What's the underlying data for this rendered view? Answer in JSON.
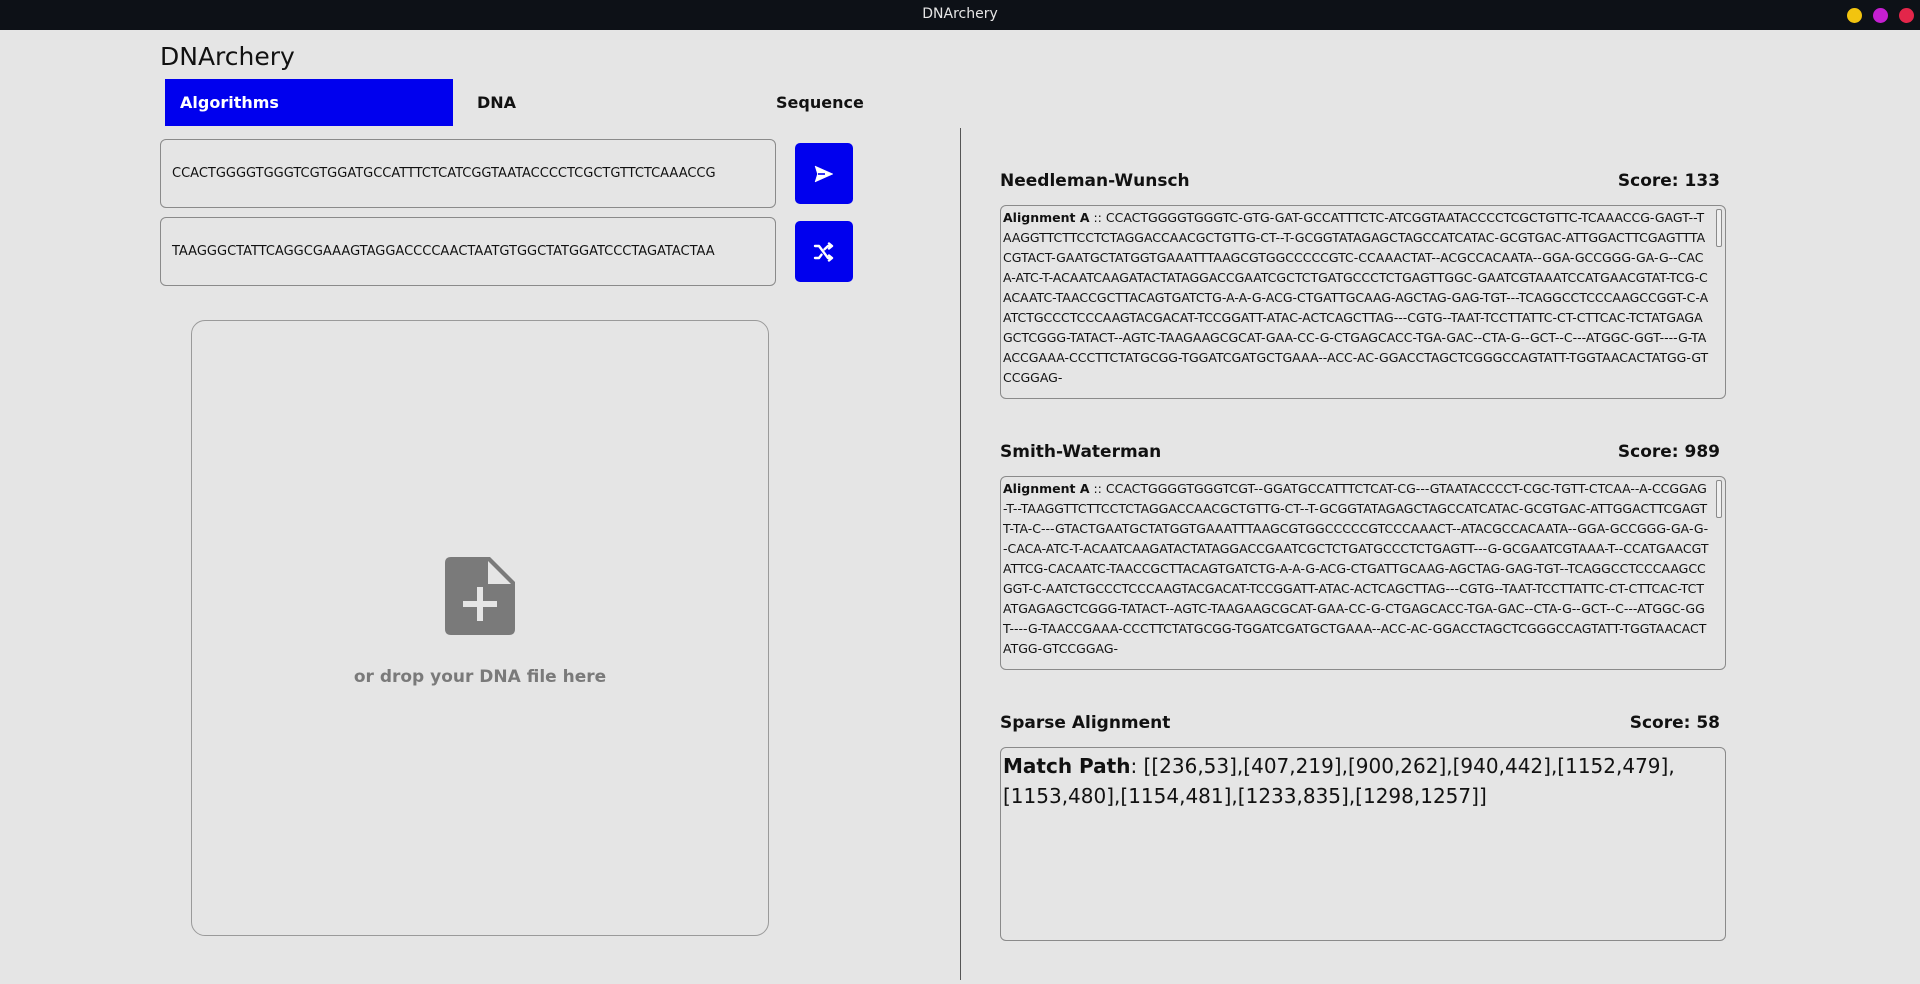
{
  "window": {
    "title": "DNArchery"
  },
  "app": {
    "title": "DNArchery"
  },
  "tabs": [
    {
      "label": "Algorithms",
      "active": true
    },
    {
      "label": "DNA",
      "active": false
    },
    {
      "label": "Sequence",
      "active": false
    }
  ],
  "inputs": {
    "sequence_a": "CCACTGGGGTGGGTCGTGGATGCCATTTCTCATCGGTAATACCCCTCGCTGTTCTCAAACCG",
    "sequence_b": "TAAGGGCTATTCAGGCGAAAGTAGGACCCCAACTAATGTGGCTATGGATCCCTAGATACTAA"
  },
  "buttons": {
    "send_icon": "send-icon",
    "shuffle_icon": "shuffle-icon"
  },
  "dropzone": {
    "icon": "file-add-icon",
    "text": "or drop your DNA file here"
  },
  "results": {
    "needleman": {
      "title": "Needleman-Wunsch",
      "score": "Score: 133",
      "label": "Alignment A",
      "separator": " :: ",
      "text": "CCACTGGGGTGGGTC-GTG-GAT-GCCATTTCTC-ATCGGTAATACCCCTCGCTGTTC-TCAAACCG-GAGT--TAAGGTTCTTCCTCTAGGACCAACGCTGTTG-CT--T-GCGGTATAGAGCTAGCCATCATAC-GCGTGAC-ATTGGACTTCGAGTTTACGTACT-GAATGCTATGGTGAAATTTAAGCGTGGCCCCCGTC-CCAAACTAT--ACGCCACAATA--GGA-GCCGGG-GA-G--CACA-ATC-T-ACAATCAAGATACTATAGGACCGAATCGCTCTGATGCCCTCTGAGTTGGC-GAATCGTAAATCCATGAACGTAT-TCG-CACAATC-TAACCGCTTACAGTGATCTG-A-A-G-ACG-CTGATTGCAAG-AGCTAG-GAG-TGT---TCAGGCCTCCCAAGCCGGT-C-AATCTGCCCTCCCAAGTACGACAT-TCCGGATT-ATAC-ACTCAGCTTAG---CGTG--TAAT-TCCTTATTC-CT-CTTCAC-TCTATGAGAGCTCGGG-TATACT--AGTC-TAAGAAGCGCAT-GAA-CC-G-CTGAGCACC-TGA-GAC--CTA-G--GCT--C---ATGGC-GGT----G-TAACCGAAA-CCCTTCTATGCGG-TGGATCGATGCTGAAA--ACC-AC-GGACCTAGCTCGGGCCAGTATT-TGGTAACACTATGG-GTCCGGAG-"
    },
    "smith": {
      "title": "Smith-Waterman",
      "score": "Score: 989",
      "label": "Alignment A",
      "separator": " :: ",
      "text": "CCACTGGGGTGGGTCGT--GGATGCCATTTCTCAT-CG---GTAATACCCCT-CGC-TGTT-CTCAA--A-CCGGAG-T--TAAGGTTCTTCCTCTAGGACCAACGCTGTTG-CT--T-GCGGTATAGAGCTAGCCATCATAC-GCGTGAC-ATTGGACTTCGAGTT-TA-C---GTACTGAATGCTATGGTGAAATTTAAGCGTGGCCCCCGTCCCAAACT--ATACGCCACAATA--GGA-GCCGGG-GA-G--CACA-ATC-T-ACAATCAAGATACTATAGGACCGAATCGCTCTGATGCCCTCTGAGTT---G-GCGAATCGTAAA-T--CCATGAACGTATTCG-CACAATC-TAACCGCTTACAGTGATCTG-A-A-G-ACG-CTGATTGCAAG-AGCTAG-GAG-TGT--TCAGGCCTCCCAAGCCGGT-C-AATCTGCCCTCCCAAGTACGACAT-TCCGGATT-ATAC-ACTCAGCTTAG---CGTG--TAAT-TCCTTATTC-CT-CTTCAC-TCTATGAGAGCTCGGG-TATACT--AGTC-TAAGAAGCGCAT-GAA-CC-G-CTGAGCACC-TGA-GAC--CTA-G--GCT--C---ATGGC-GGT----G-TAACCGAAA-CCCTTCTATGCGG-TGGATCGATGCTGAAA--ACC-AC-GGACCTAGCTCGGGCCAGTATT-TGGTAACACTATGG-GTCCGGAG-"
    },
    "sparse": {
      "title": "Sparse Alignment",
      "score": "Score: 58",
      "label": "Match Path",
      "separator": ": ",
      "text": "[[236,53],[407,219],[900,262],[940,442],[1152,479],[1153,480],[1154,481],[1233,835],[1298,1257]]"
    }
  },
  "colors": {
    "accent": "#0000ee",
    "background": "#e5e5e5",
    "titlebar": "#0d1117"
  }
}
